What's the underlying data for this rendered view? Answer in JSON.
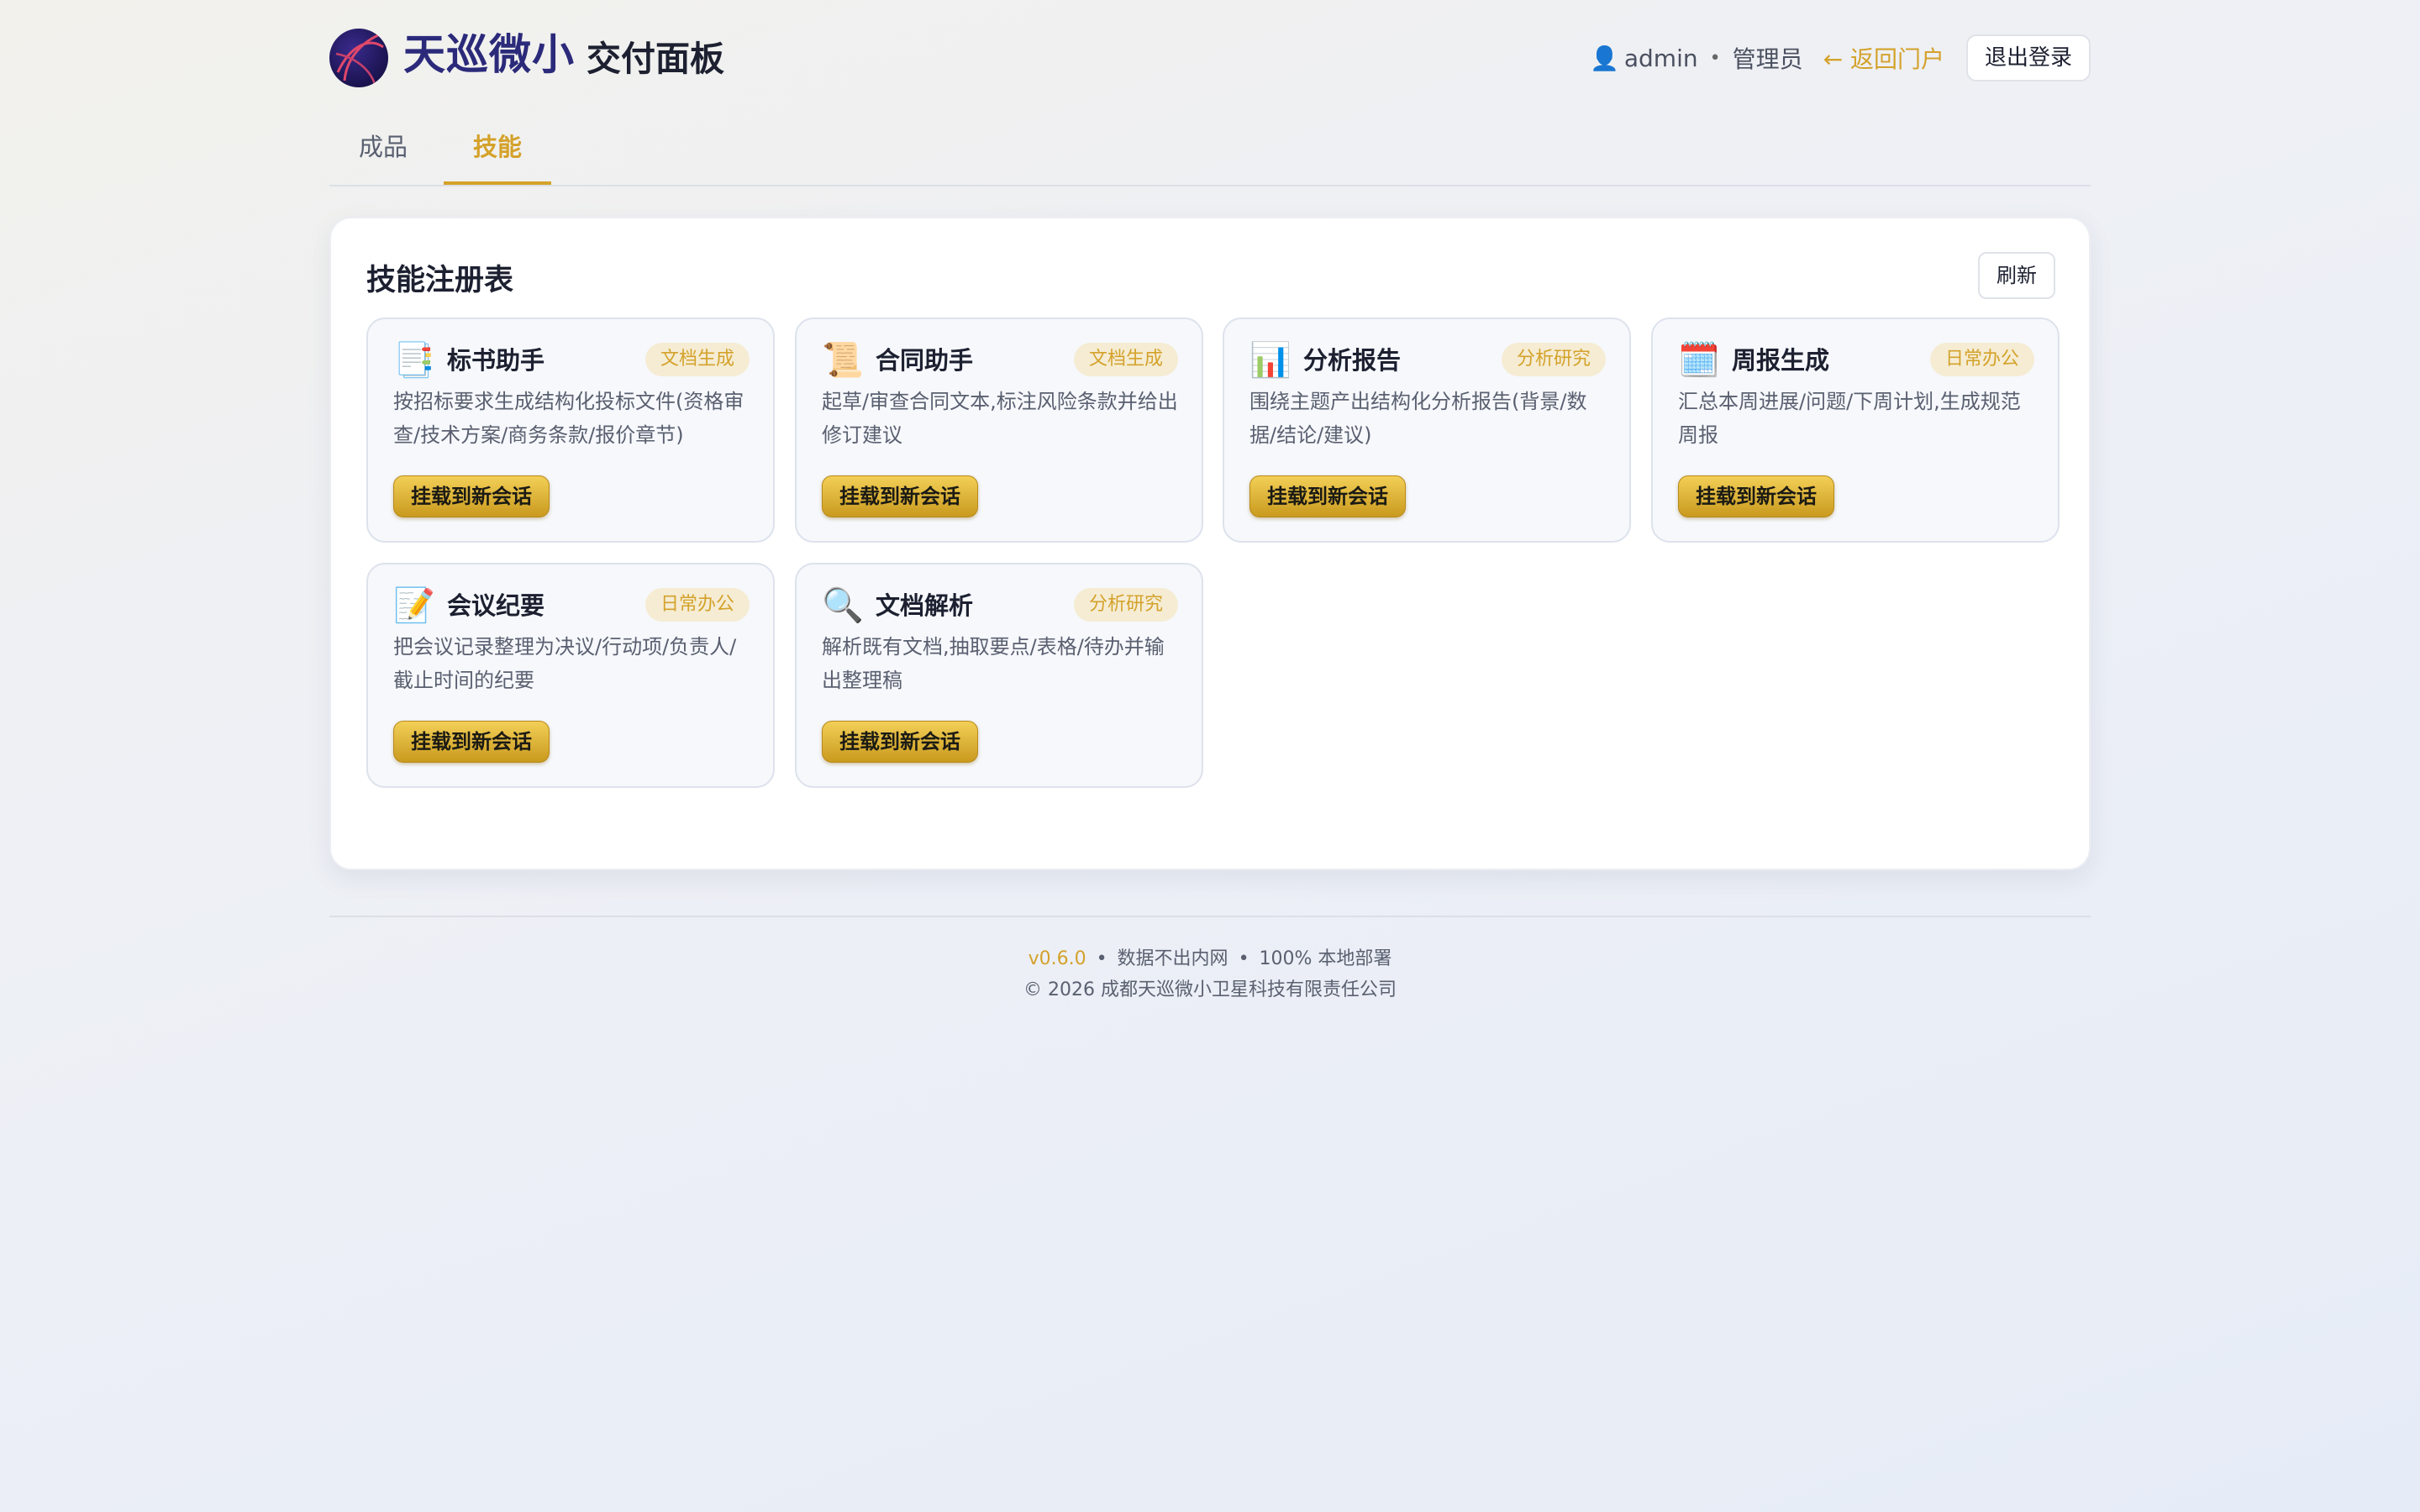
{
  "header": {
    "brand": "天巡微小",
    "subtitle": "交付面板",
    "user_icon": "user-icon",
    "username": "admin",
    "role": "管理员",
    "back_link": "← 返回门户",
    "logout": "退出登录"
  },
  "tabs": [
    {
      "label": "成品",
      "active": false
    },
    {
      "label": "技能",
      "active": true
    }
  ],
  "panel": {
    "title": "技能注册表",
    "refresh": "刷新",
    "cards": [
      {
        "icon": "📑",
        "icon_name": "bookmark-tabs-icon",
        "title": "标书助手",
        "tag": "文档生成",
        "desc": "按招标要求生成结构化投标文件(资格审查/技术方案/商务条款/报价章节)",
        "button": "挂载到新会话"
      },
      {
        "icon": "📜",
        "icon_name": "scroll-icon",
        "title": "合同助手",
        "tag": "文档生成",
        "desc": "起草/审查合同文本,标注风险条款并给出修订建议",
        "button": "挂载到新会话"
      },
      {
        "icon": "📊",
        "icon_name": "bar-chart-icon",
        "title": "分析报告",
        "tag": "分析研究",
        "desc": "围绕主题产出结构化分析报告(背景/数据/结论/建议)",
        "button": "挂载到新会话"
      },
      {
        "icon": "🗓️",
        "icon_name": "calendar-icon",
        "title": "周报生成",
        "tag": "日常办公",
        "desc": "汇总本周进展/问题/下周计划,生成规范周报",
        "button": "挂载到新会话"
      },
      {
        "icon": "📝",
        "icon_name": "memo-icon",
        "title": "会议纪要",
        "tag": "日常办公",
        "desc": "把会议记录整理为决议/行动项/负责人/截止时间的纪要",
        "button": "挂载到新会话"
      },
      {
        "icon": "🔍",
        "icon_name": "magnifier-icon",
        "title": "文档解析",
        "tag": "分析研究",
        "desc": "解析既有文档,抽取要点/表格/待办并输出整理稿",
        "button": "挂载到新会话"
      }
    ]
  },
  "footer": {
    "version": "v0.6.0",
    "note1": "数据不出内网",
    "note2": "100% 本地部署",
    "copyright": "© 2026 成都天巡微小卫星科技有限责任公司"
  },
  "colors": {
    "accent": "#d4a22b",
    "brand": "#2b2a7a"
  }
}
